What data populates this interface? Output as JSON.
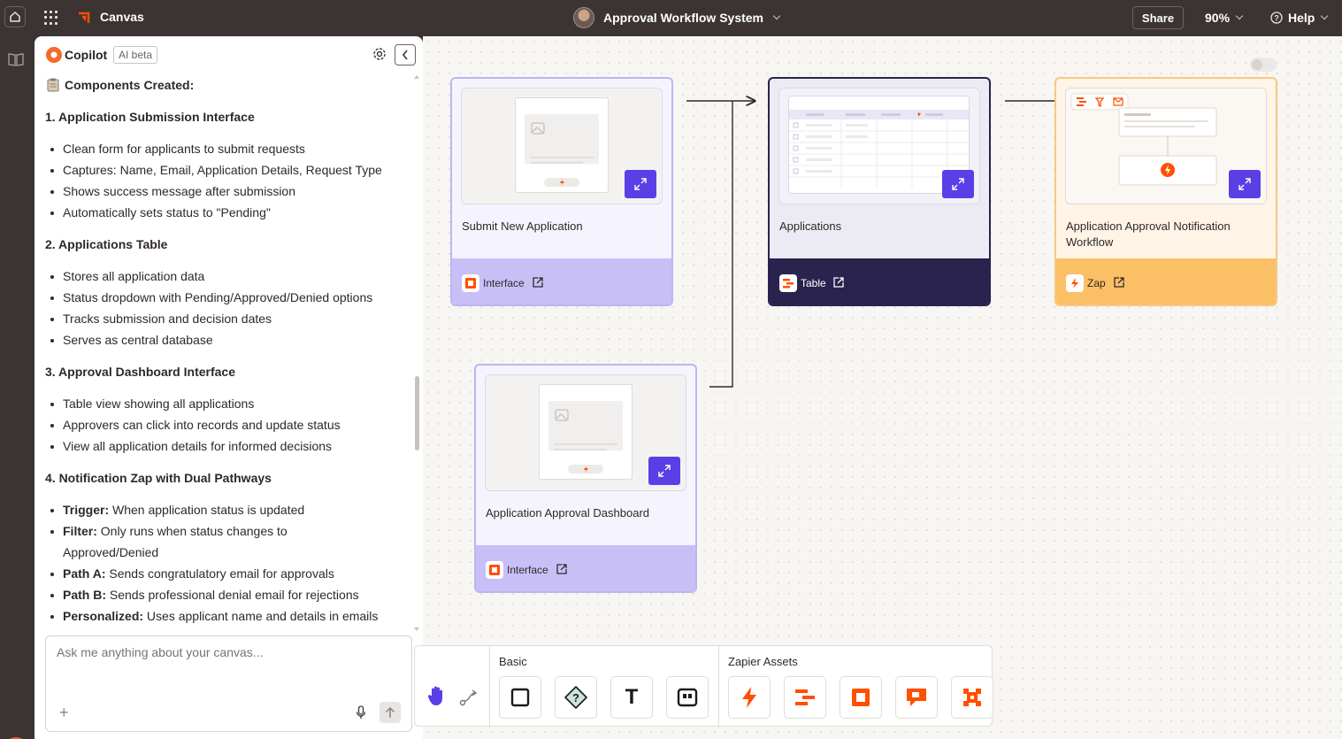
{
  "topbar": {
    "app_name": "Canvas",
    "canvas_title": "Approval Workflow System",
    "share_label": "Share",
    "zoom_level": "90%",
    "help_label": "Help"
  },
  "copilot": {
    "title": "Copilot",
    "badge": "AI beta",
    "content": {
      "section_heading": "Components Created:",
      "s1_heading": "1. Application Submission Interface",
      "s1_items": [
        "Clean form for applicants to submit requests",
        "Captures: Name, Email, Application Details, Request Type",
        "Shows success message after submission",
        "Automatically sets status to \"Pending\""
      ],
      "s2_heading": "2. Applications Table",
      "s2_items": [
        "Stores all application data",
        "Status dropdown with Pending/Approved/Denied options",
        "Tracks submission and decision dates",
        "Serves as central database"
      ],
      "s3_heading": "3. Approval Dashboard Interface",
      "s3_items": [
        "Table view showing all applications",
        "Approvers can click into records and update status",
        "View all application details for informed decisions"
      ],
      "s4_heading": "4. Notification Zap with Dual Pathways",
      "s4_items": [
        {
          "label": "Trigger:",
          "text": "When application status is updated"
        },
        {
          "label": "Filter:",
          "text": "Only runs when status changes to"
        },
        {
          "label": "",
          "text": "Approved/Denied"
        },
        {
          "label": "Path A:",
          "text": "Sends congratulatory email for approvals"
        },
        {
          "label": "Path B:",
          "text": "Sends professional denial email for rejections"
        },
        {
          "label": "Personalized:",
          "text": "Uses applicant name and details in emails"
        }
      ]
    },
    "chat_placeholder": "Ask me anything about your canvas..."
  },
  "canvas": {
    "cards": [
      {
        "name": "Submit New Application",
        "type_label": "Interface"
      },
      {
        "name": "Applications",
        "type_label": "Table"
      },
      {
        "name": "Application Approval Notification Workflow",
        "type_label": "Zap"
      },
      {
        "name": "Application Approval Dashboard",
        "type_label": "Interface"
      }
    ]
  },
  "toolbar": {
    "basic_label": "Basic",
    "zapier_assets_label": "Zapier Assets",
    "text_tool_glyph": "T"
  },
  "colors": {
    "accent_purple": "#5b3fe6",
    "zapier_orange": "#ff4f00",
    "table_navy": "#2a234d"
  }
}
